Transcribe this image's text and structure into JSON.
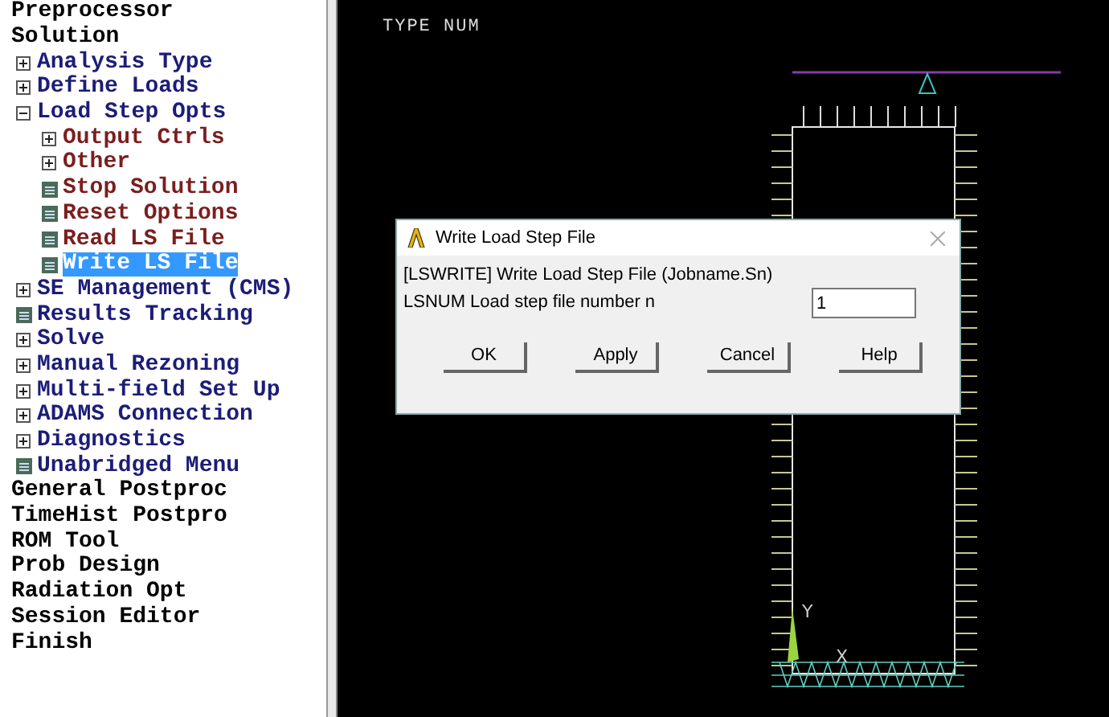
{
  "tree": [
    {
      "label": "Preprocessor",
      "kind": "top",
      "selected": false
    },
    {
      "label": "Solution",
      "kind": "top",
      "selected": false,
      "children": [
        {
          "label": "Analysis Type",
          "kind": "folder",
          "expanded": false,
          "selected": false
        },
        {
          "label": "Define Loads",
          "kind": "folder",
          "expanded": false,
          "selected": false
        },
        {
          "label": "Load Step Opts",
          "kind": "folder",
          "expanded": true,
          "selected": false,
          "children": [
            {
              "label": "Output Ctrls",
              "kind": "folder",
              "expanded": false,
              "selected": false
            },
            {
              "label": "Other",
              "kind": "folder",
              "expanded": false,
              "selected": false
            },
            {
              "label": "Stop Solution",
              "kind": "command",
              "selected": false
            },
            {
              "label": "Reset Options",
              "kind": "command",
              "selected": false
            },
            {
              "label": "Read LS File",
              "kind": "command",
              "selected": false
            },
            {
              "label": "Write LS File",
              "kind": "command",
              "selected": true
            }
          ]
        },
        {
          "label": "SE Management (CMS)",
          "kind": "folder",
          "expanded": false,
          "selected": false
        },
        {
          "label": "Results Tracking",
          "kind": "command",
          "selected": false
        },
        {
          "label": "Solve",
          "kind": "folder",
          "expanded": false,
          "selected": false
        },
        {
          "label": "Manual Rezoning",
          "kind": "folder",
          "expanded": false,
          "selected": false
        },
        {
          "label": "Multi-field Set Up",
          "kind": "folder",
          "expanded": false,
          "selected": false
        },
        {
          "label": "ADAMS Connection",
          "kind": "folder",
          "expanded": false,
          "selected": false
        },
        {
          "label": "Diagnostics",
          "kind": "folder",
          "expanded": false,
          "selected": false
        },
        {
          "label": "Unabridged Menu",
          "kind": "command",
          "selected": false
        }
      ]
    },
    {
      "label": "General Postproc",
      "kind": "top",
      "selected": false
    },
    {
      "label": "TimeHist Postpro",
      "kind": "top",
      "selected": false
    },
    {
      "label": "ROM Tool",
      "kind": "top",
      "selected": false
    },
    {
      "label": "Prob Design",
      "kind": "top",
      "selected": false
    },
    {
      "label": "Radiation Opt",
      "kind": "top",
      "selected": false
    },
    {
      "label": "Session Editor",
      "kind": "top",
      "selected": false
    },
    {
      "label": "Finish",
      "kind": "top",
      "selected": false
    }
  ],
  "graphics": {
    "heading": "TYPE NUM",
    "axis_y": "Y",
    "axis_x": "X"
  },
  "dialog": {
    "title": "Write Load Step File",
    "command_line": "[LSWRITE]  Write Load Step File (Jobname.Sn)",
    "field_label": "LSNUM  Load step file number n",
    "field_value": "1",
    "buttons": [
      "OK",
      "Apply",
      "Cancel",
      "Help"
    ]
  }
}
